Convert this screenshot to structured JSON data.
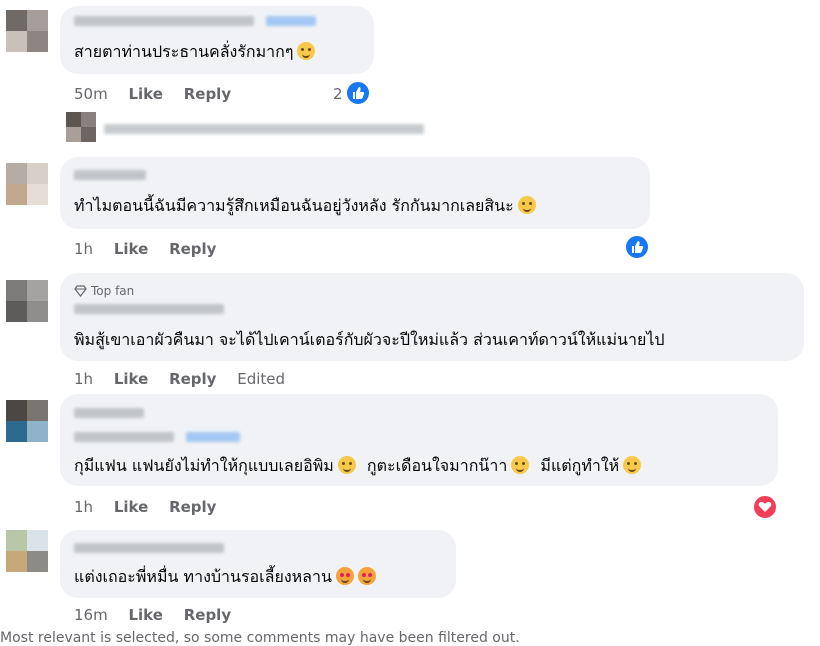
{
  "comments": [
    {
      "text": "สายตาท่านประธานคลั่งรักมากๆ",
      "time": "50m",
      "like": "Like",
      "reply": "Reply",
      "reaction_count": "2",
      "reaction": "like"
    },
    {
      "text": "ทำไมตอนนี้ฉันมีความรู้สึกเหมือนฉันอยู่วังหลัง รักกันมากเลยสินะ",
      "time": "1h",
      "like": "Like",
      "reply": "Reply",
      "reaction": "like"
    },
    {
      "badge": "Top fan",
      "text": "พิมสู้เขาเอาผัวคืนมา จะได้ไปเคาน์เตอร์กับผัวจะปีใหม่แล้ว ส่วนเคาท์ดาวน์ให้แม่นายไป",
      "time": "1h",
      "like": "Like",
      "reply": "Reply",
      "edited": "Edited"
    },
    {
      "text_parts": [
        "กุมีแฟน แฟนยังไม่ทำให้กุแบบเลยอิพิม",
        "กูตะเดือนใจมากน๊าา",
        "มีแต่กูทำให้"
      ],
      "time": "1h",
      "like": "Like",
      "reply": "Reply",
      "reaction": "love"
    },
    {
      "text": "แต่งเถอะพี่หมื่น ทางบ้านรอเลี้ยงหลาน",
      "time": "16m",
      "like": "Like",
      "reply": "Reply"
    }
  ],
  "footer_text": "Most relevant is selected, so some comments may have been filtered out.",
  "colors": {
    "bubble": "#f0f2f5",
    "link": "#1877f2",
    "meta": "#65676b",
    "love": "#f33e58"
  }
}
